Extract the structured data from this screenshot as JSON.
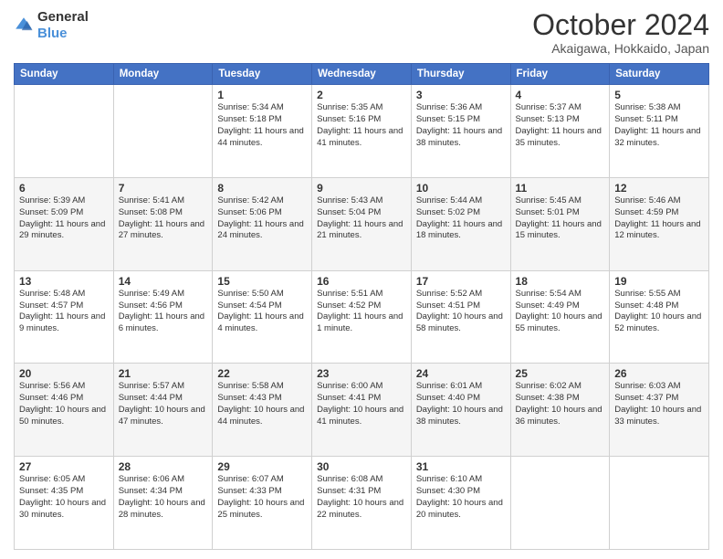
{
  "header": {
    "logo_general": "General",
    "logo_blue": "Blue",
    "month": "October 2024",
    "location": "Akaigawa, Hokkaido, Japan"
  },
  "days_of_week": [
    "Sunday",
    "Monday",
    "Tuesday",
    "Wednesday",
    "Thursday",
    "Friday",
    "Saturday"
  ],
  "weeks": [
    [
      {
        "day": "",
        "info": ""
      },
      {
        "day": "",
        "info": ""
      },
      {
        "day": "1",
        "info": "Sunrise: 5:34 AM\nSunset: 5:18 PM\nDaylight: 11 hours and 44 minutes."
      },
      {
        "day": "2",
        "info": "Sunrise: 5:35 AM\nSunset: 5:16 PM\nDaylight: 11 hours and 41 minutes."
      },
      {
        "day": "3",
        "info": "Sunrise: 5:36 AM\nSunset: 5:15 PM\nDaylight: 11 hours and 38 minutes."
      },
      {
        "day": "4",
        "info": "Sunrise: 5:37 AM\nSunset: 5:13 PM\nDaylight: 11 hours and 35 minutes."
      },
      {
        "day": "5",
        "info": "Sunrise: 5:38 AM\nSunset: 5:11 PM\nDaylight: 11 hours and 32 minutes."
      }
    ],
    [
      {
        "day": "6",
        "info": "Sunrise: 5:39 AM\nSunset: 5:09 PM\nDaylight: 11 hours and 29 minutes."
      },
      {
        "day": "7",
        "info": "Sunrise: 5:41 AM\nSunset: 5:08 PM\nDaylight: 11 hours and 27 minutes."
      },
      {
        "day": "8",
        "info": "Sunrise: 5:42 AM\nSunset: 5:06 PM\nDaylight: 11 hours and 24 minutes."
      },
      {
        "day": "9",
        "info": "Sunrise: 5:43 AM\nSunset: 5:04 PM\nDaylight: 11 hours and 21 minutes."
      },
      {
        "day": "10",
        "info": "Sunrise: 5:44 AM\nSunset: 5:02 PM\nDaylight: 11 hours and 18 minutes."
      },
      {
        "day": "11",
        "info": "Sunrise: 5:45 AM\nSunset: 5:01 PM\nDaylight: 11 hours and 15 minutes."
      },
      {
        "day": "12",
        "info": "Sunrise: 5:46 AM\nSunset: 4:59 PM\nDaylight: 11 hours and 12 minutes."
      }
    ],
    [
      {
        "day": "13",
        "info": "Sunrise: 5:48 AM\nSunset: 4:57 PM\nDaylight: 11 hours and 9 minutes."
      },
      {
        "day": "14",
        "info": "Sunrise: 5:49 AM\nSunset: 4:56 PM\nDaylight: 11 hours and 6 minutes."
      },
      {
        "day": "15",
        "info": "Sunrise: 5:50 AM\nSunset: 4:54 PM\nDaylight: 11 hours and 4 minutes."
      },
      {
        "day": "16",
        "info": "Sunrise: 5:51 AM\nSunset: 4:52 PM\nDaylight: 11 hours and 1 minute."
      },
      {
        "day": "17",
        "info": "Sunrise: 5:52 AM\nSunset: 4:51 PM\nDaylight: 10 hours and 58 minutes."
      },
      {
        "day": "18",
        "info": "Sunrise: 5:54 AM\nSunset: 4:49 PM\nDaylight: 10 hours and 55 minutes."
      },
      {
        "day": "19",
        "info": "Sunrise: 5:55 AM\nSunset: 4:48 PM\nDaylight: 10 hours and 52 minutes."
      }
    ],
    [
      {
        "day": "20",
        "info": "Sunrise: 5:56 AM\nSunset: 4:46 PM\nDaylight: 10 hours and 50 minutes."
      },
      {
        "day": "21",
        "info": "Sunrise: 5:57 AM\nSunset: 4:44 PM\nDaylight: 10 hours and 47 minutes."
      },
      {
        "day": "22",
        "info": "Sunrise: 5:58 AM\nSunset: 4:43 PM\nDaylight: 10 hours and 44 minutes."
      },
      {
        "day": "23",
        "info": "Sunrise: 6:00 AM\nSunset: 4:41 PM\nDaylight: 10 hours and 41 minutes."
      },
      {
        "day": "24",
        "info": "Sunrise: 6:01 AM\nSunset: 4:40 PM\nDaylight: 10 hours and 38 minutes."
      },
      {
        "day": "25",
        "info": "Sunrise: 6:02 AM\nSunset: 4:38 PM\nDaylight: 10 hours and 36 minutes."
      },
      {
        "day": "26",
        "info": "Sunrise: 6:03 AM\nSunset: 4:37 PM\nDaylight: 10 hours and 33 minutes."
      }
    ],
    [
      {
        "day": "27",
        "info": "Sunrise: 6:05 AM\nSunset: 4:35 PM\nDaylight: 10 hours and 30 minutes."
      },
      {
        "day": "28",
        "info": "Sunrise: 6:06 AM\nSunset: 4:34 PM\nDaylight: 10 hours and 28 minutes."
      },
      {
        "day": "29",
        "info": "Sunrise: 6:07 AM\nSunset: 4:33 PM\nDaylight: 10 hours and 25 minutes."
      },
      {
        "day": "30",
        "info": "Sunrise: 6:08 AM\nSunset: 4:31 PM\nDaylight: 10 hours and 22 minutes."
      },
      {
        "day": "31",
        "info": "Sunrise: 6:10 AM\nSunset: 4:30 PM\nDaylight: 10 hours and 20 minutes."
      },
      {
        "day": "",
        "info": ""
      },
      {
        "day": "",
        "info": ""
      }
    ]
  ]
}
